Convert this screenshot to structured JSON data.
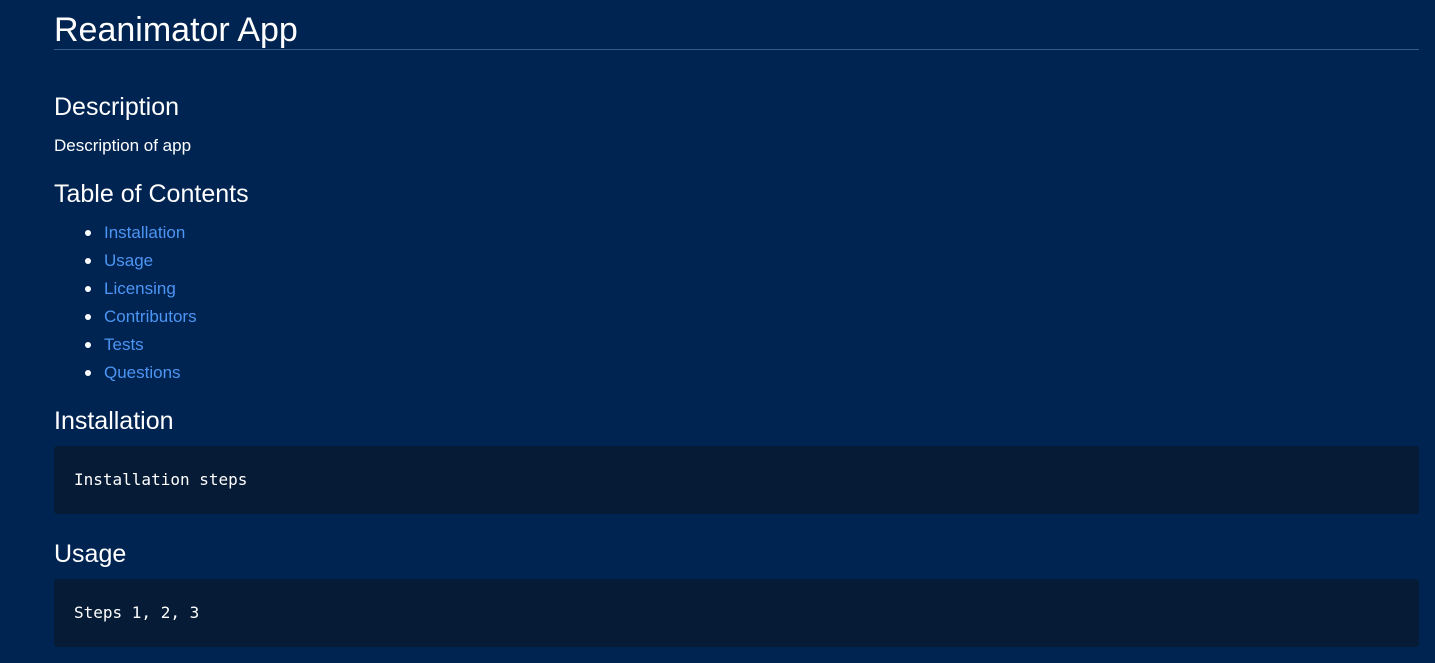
{
  "title": "Reanimator App",
  "description": {
    "heading": "Description",
    "text": "Description of app"
  },
  "toc": {
    "heading": "Table of Contents",
    "items": [
      {
        "label": "Installation"
      },
      {
        "label": "Usage"
      },
      {
        "label": "Licensing"
      },
      {
        "label": "Contributors"
      },
      {
        "label": "Tests"
      },
      {
        "label": "Questions"
      }
    ]
  },
  "installation": {
    "heading": "Installation",
    "code": "Installation steps"
  },
  "usage": {
    "heading": "Usage",
    "code": "Steps 1, 2, 3"
  },
  "colors": {
    "background": "#002451",
    "link": "#4d95f4",
    "code_background": "#061b36"
  }
}
